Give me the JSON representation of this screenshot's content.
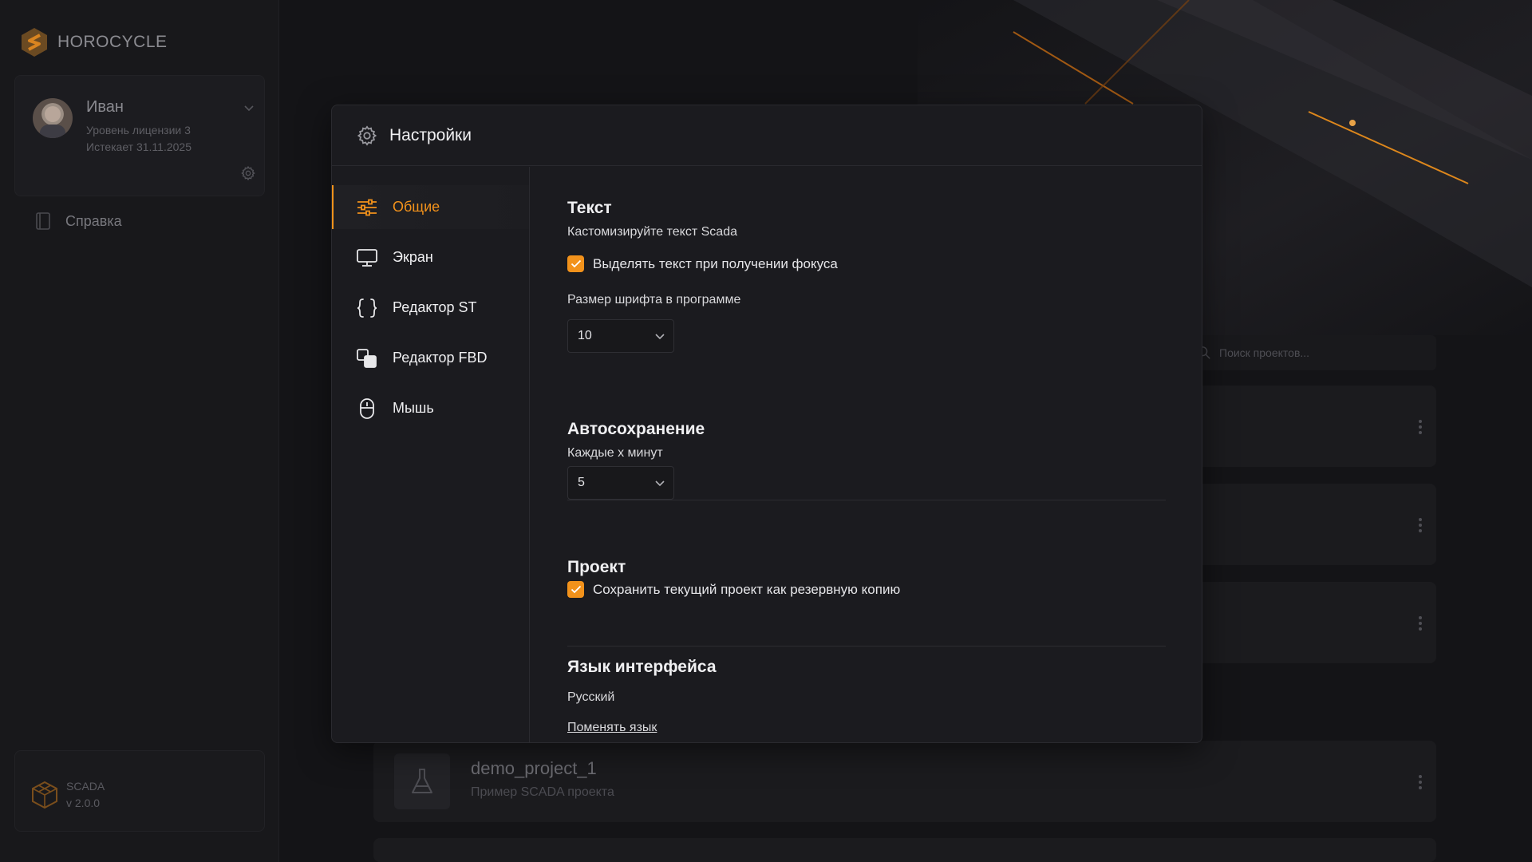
{
  "app": {
    "logo_text": "HOROCYCLE"
  },
  "user": {
    "name": "Иван",
    "license": "Уровень лицензии 3",
    "expires": "Истекает 31.11.2025"
  },
  "sidebar": {
    "help_label": "Справка"
  },
  "version": {
    "product": "SCADA",
    "number": "v 2.0.0"
  },
  "projects": {
    "search_placeholder": "Поиск проектов...",
    "items": [
      {
        "name": "demo_project_1",
        "description": "Пример SCADA проекта"
      }
    ]
  },
  "settings": {
    "title": "Настройки",
    "nav": [
      {
        "label": "Общие",
        "icon": "sliders-icon",
        "active": true
      },
      {
        "label": "Экран",
        "icon": "monitor-icon"
      },
      {
        "label": "Редактор ST",
        "icon": "braces-icon"
      },
      {
        "label": "Редактор FBD",
        "icon": "blocks-icon"
      },
      {
        "label": "Мышь",
        "icon": "mouse-icon"
      }
    ],
    "text_section": {
      "title": "Текст",
      "subtitle": "Кастомизируйте текст Scada",
      "highlight_label": "Выделять текст при получении фокуса",
      "highlight_checked": true,
      "font_size_label": "Размер шрифта в программе",
      "font_size_value": "10"
    },
    "autosave_section": {
      "title": "Автосохранение",
      "subtitle": "Каждые x минут",
      "interval_value": "5"
    },
    "project_section": {
      "title": "Проект",
      "backup_label": "Сохранить текущий проект как резервную копию",
      "backup_checked": true
    },
    "language_section": {
      "title": "Язык интерфейса",
      "current": "Русский",
      "change_link": "Поменять язык"
    }
  },
  "colors": {
    "accent": "#f2921b",
    "background": "#141417",
    "panel": "#1b1b1f"
  }
}
